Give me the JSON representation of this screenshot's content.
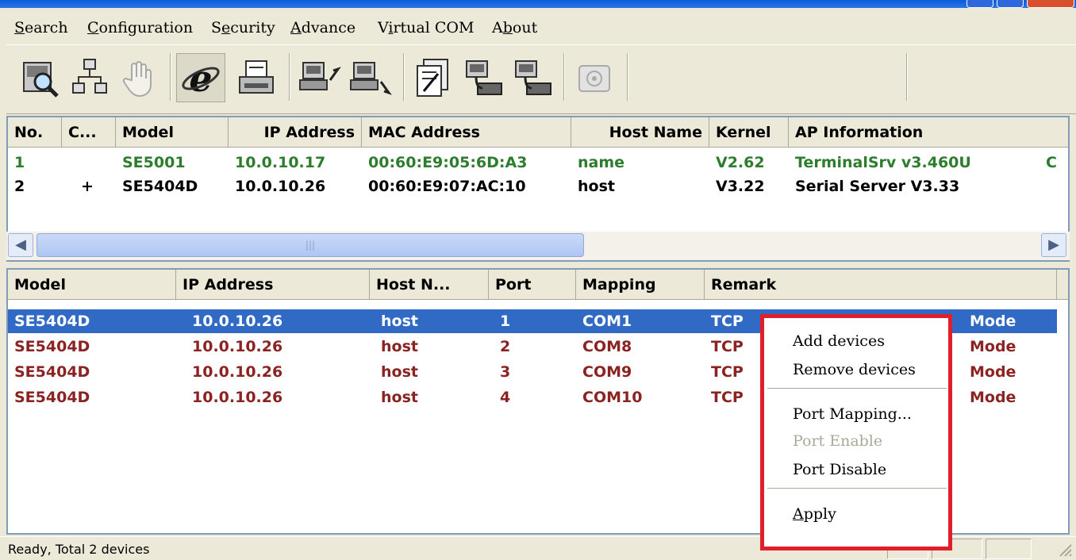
{
  "menu": {
    "items": [
      {
        "label": "Search",
        "underline": "S",
        "rest": "earch"
      },
      {
        "label": "Configuration",
        "underline": "C",
        "rest": "onfiguration"
      },
      {
        "label": "Security",
        "pre": "S",
        "underline": "e",
        "rest": "curity"
      },
      {
        "label": "Advance",
        "underline": "A",
        "rest": "dvance"
      },
      {
        "label": "Virtual COM",
        "pre": "V",
        "underline": "i",
        "rest": "rtual COM"
      },
      {
        "label": "About",
        "pre": "A",
        "underline": "b",
        "rest": "out"
      }
    ]
  },
  "toolbar": {
    "icons": [
      "search-device-icon",
      "network-config-icon",
      "locate-hand-icon",
      "internet-explorer-icon",
      "print-icon",
      "add-server-icon",
      "remove-server-icon",
      "settings-form-icon",
      "serial-port-icon",
      "serial-port-2-icon",
      "telephone-icon"
    ]
  },
  "device_list": {
    "columns": [
      "No.",
      "C...",
      "Model",
      "IP Address",
      "MAC Address",
      "Host Name",
      "Kernel",
      "AP Information"
    ],
    "rows": [
      {
        "no": "1",
        "c": "",
        "model": "SE5001",
        "ip": "10.0.10.17",
        "mac": "00:60:E9:05:6D:A3",
        "host": "name",
        "kernel": "V2.62",
        "ap": "TerminalSrv v3.460U",
        "extra": "C",
        "color": "#2e7d2e"
      },
      {
        "no": "2",
        "c": "+",
        "model": "SE5404D",
        "ip": "10.0.10.26",
        "mac": "00:60:E9:07:AC:10",
        "host": "host",
        "kernel": "V3.22",
        "ap": "Serial Server V3.33",
        "extra": "",
        "color": "#000000"
      }
    ]
  },
  "port_list": {
    "columns": [
      "Model",
      "IP Address",
      "Host N...",
      "Port",
      "Mapping",
      "Remark"
    ],
    "rows": [
      {
        "model": "SE5404D",
        "ip": "10.0.10.26",
        "host": "host",
        "port": "1",
        "mapping": "COM1",
        "remark_a": "TCP",
        "remark_b": "Mode",
        "selected": true
      },
      {
        "model": "SE5404D",
        "ip": "10.0.10.26",
        "host": "host",
        "port": "2",
        "mapping": "COM8",
        "remark_a": "TCP",
        "remark_b": "Mode",
        "selected": false
      },
      {
        "model": "SE5404D",
        "ip": "10.0.10.26",
        "host": "host",
        "port": "3",
        "mapping": "COM9",
        "remark_a": "TCP",
        "remark_b": "Mode",
        "selected": false
      },
      {
        "model": "SE5404D",
        "ip": "10.0.10.26",
        "host": "host",
        "port": "4",
        "mapping": "COM10",
        "remark_a": "TCP",
        "remark_b": "Mode",
        "selected": false
      }
    ],
    "row_color": "#8b2323",
    "selected_color": "#316ac5"
  },
  "context_menu": {
    "add_devices": "Add devices",
    "remove_devices": "Remove devices",
    "port_mapping": "Port Mapping...",
    "port_enable": "Port Enable",
    "port_disable": "Port Disable",
    "apply_underline": "A",
    "apply_rest": "pply",
    "highlight_color": "#e01f2a"
  },
  "status": {
    "text": "Ready, Total 2 devices"
  }
}
